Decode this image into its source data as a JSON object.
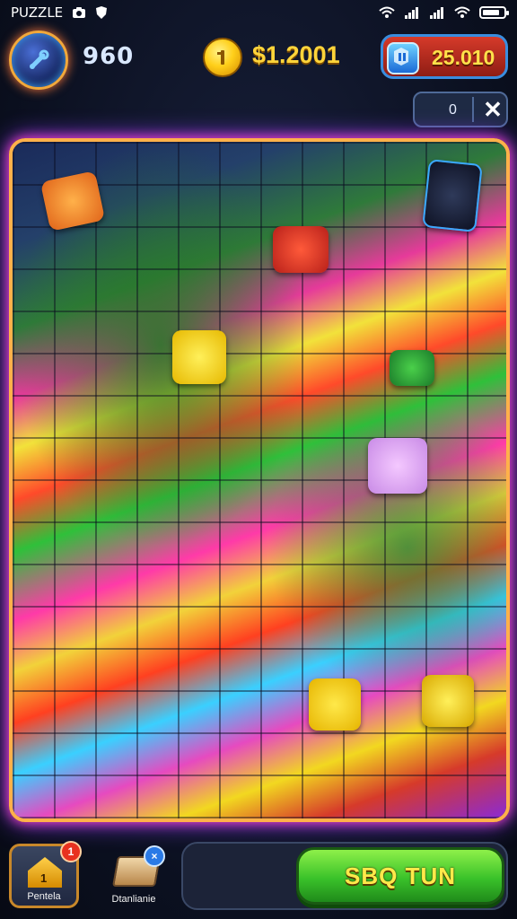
{
  "status_bar": {
    "app_title": "PUZZLE",
    "icons": [
      "camera-icon",
      "shield-icon",
      "wifi-icon",
      "signal-icon",
      "battery-icon"
    ]
  },
  "hud": {
    "level_value": "960",
    "coins_value": "$1.2001",
    "gems_value": "25.010"
  },
  "counter": {
    "value": "0",
    "close_symbol": "✕"
  },
  "board": {
    "pieces": [
      "orange",
      "dark",
      "red",
      "yellow",
      "green",
      "lilac",
      "yellow",
      "yellow"
    ]
  },
  "bottom": {
    "home_label": "Pentela",
    "home_badge": "1",
    "home_icon_number": "1",
    "inventory_label": "Dtanlianie",
    "inventory_badge": "×",
    "play_label": "SBQ TUN"
  },
  "colors": {
    "accent_orange": "#ffb14a",
    "glow_magenta": "#ff3fbf",
    "coin_yellow": "#ffd43a",
    "play_green": "#3ac22a",
    "gem_red": "#d63a2a"
  }
}
